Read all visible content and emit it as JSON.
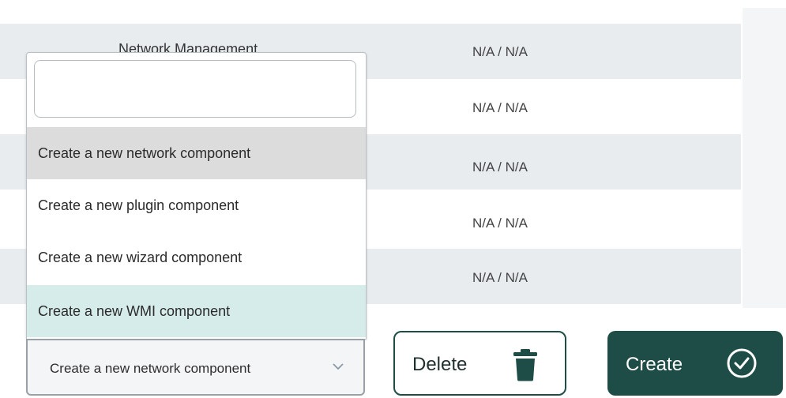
{
  "table": {
    "rows": [
      {
        "name": "Network Management",
        "value": "N/A / N/A"
      },
      {
        "name": "",
        "value": "N/A / N/A"
      },
      {
        "name": "",
        "value": "N/A / N/A"
      },
      {
        "name": "",
        "value": "N/A / N/A"
      },
      {
        "name": "",
        "value": "N/A / N/A"
      }
    ]
  },
  "dropdown": {
    "search": {
      "value": "",
      "placeholder": ""
    },
    "options": [
      {
        "label": "Create a new network component",
        "state": "selected"
      },
      {
        "label": "Create a new plugin component",
        "state": "normal"
      },
      {
        "label": "Create a new wizard component",
        "state": "normal"
      },
      {
        "label": "Create a new WMI component",
        "state": "hover"
      }
    ],
    "selected_value": "Create a new network component"
  },
  "actions": {
    "delete_label": "Delete",
    "create_label": "Create"
  },
  "icons": {
    "delete": "trash-icon",
    "create": "check-circle-icon",
    "select": "chevron-down-icon"
  },
  "colors": {
    "primary": "#1e4d47",
    "row_shade": "#e8ecef",
    "option_selected": "#dcdcdc",
    "option_hover": "#d6ecea"
  }
}
